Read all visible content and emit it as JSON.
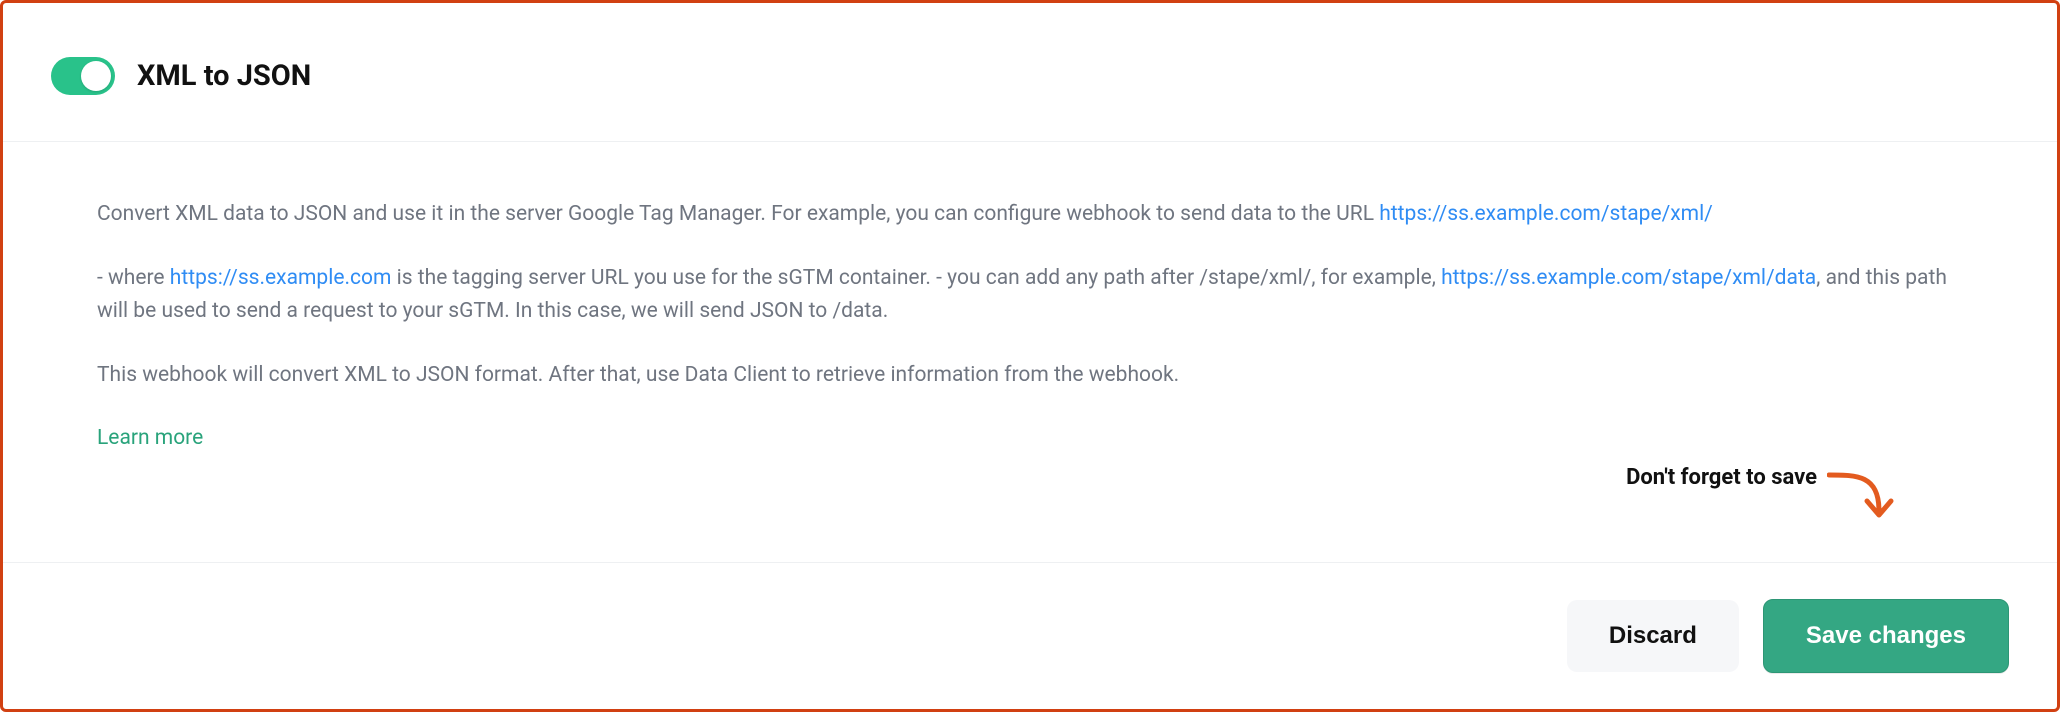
{
  "header": {
    "title": "XML to JSON",
    "toggle_on": true
  },
  "content": {
    "p1_before_link": "Convert XML data to JSON and use it in the server Google Tag Manager. For example, you can configure webhook to send data to the URL ",
    "p1_link": "https://ss.example.com/stape/xml/",
    "p2_seg1": "- where ",
    "p2_link1": "https://ss.example.com",
    "p2_seg2": " is the tagging server URL you use for the sGTM container. - you can add any path after /stape/xml/, for example, ",
    "p2_link2": "https://ss.example.com/stape/xml/data",
    "p2_seg3": ", and this path will be used to send a request to your sGTM. In this case, we will send JSON to /data.",
    "p3": "This webhook will convert XML to JSON format. After that, use Data Client to retrieve information from the webhook.",
    "learn_more": "Learn more"
  },
  "annotation": {
    "text": "Don't forget to save"
  },
  "footer": {
    "discard": "Discard",
    "save": "Save changes"
  },
  "colors": {
    "accent_green": "#29c28a",
    "link_blue": "#2f8cf4",
    "annotation_orange": "#e35b1f"
  }
}
